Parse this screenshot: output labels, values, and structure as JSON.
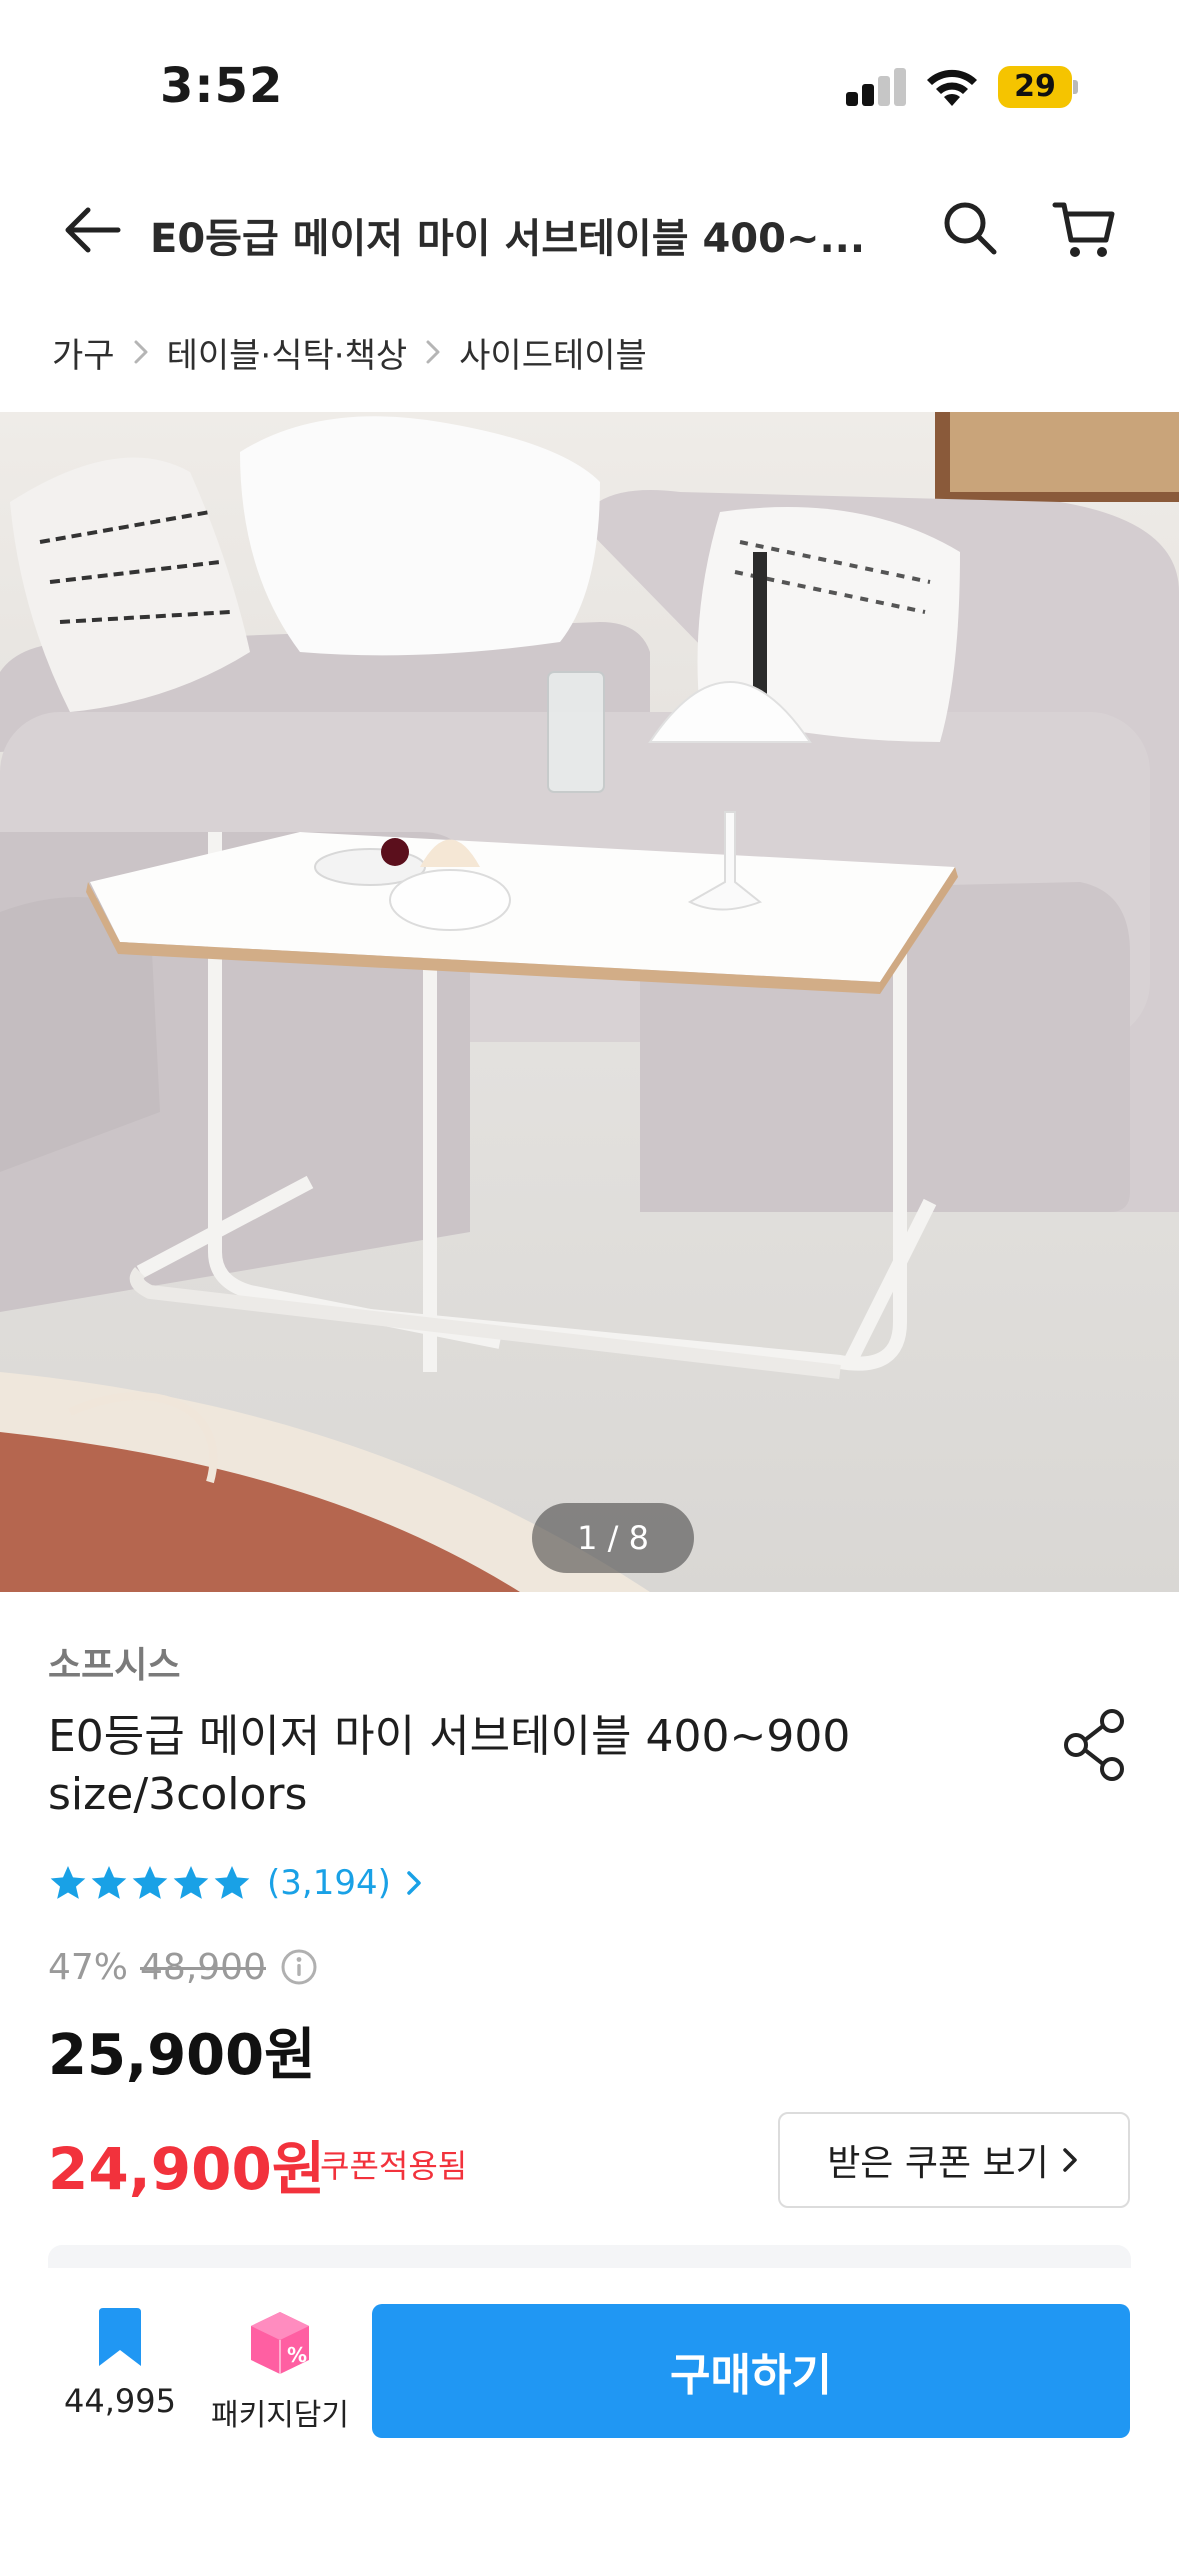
{
  "status_bar": {
    "time": "3:52",
    "battery": "29"
  },
  "header": {
    "title": "E0등급 메이저 마이 서브테이블 400~..."
  },
  "breadcrumb": [
    "가구",
    "테이블·식탁·책상",
    "사이드테이블"
  ],
  "image": {
    "counter": "1 / 8"
  },
  "product": {
    "brand": "소프시스",
    "title": "E0등급 메이저 마이 서브테이블 400~900 size/3colors",
    "rating": 5,
    "review_count": "(3,194)",
    "discount_rate": "47%",
    "original_price": "48,900",
    "sale_price": "25,900원",
    "coupon_price": "24,900원",
    "coupon_applied": "쿠폰적용됨",
    "coupon_button": "받은 쿠폰 보기"
  },
  "bottom_bar": {
    "bookmark_count": "44,995",
    "package_label": "패키지담기",
    "buy_label": "구매하기"
  },
  "colors": {
    "accent_blue": "#2097f3",
    "price_red": "#f2323c",
    "star_blue": "#19a1e6"
  }
}
